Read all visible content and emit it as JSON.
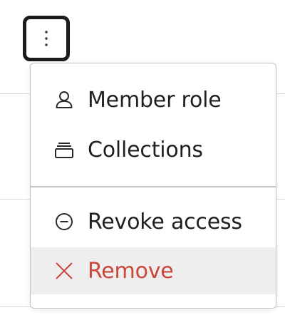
{
  "kebab_button": {
    "icon": "vertical-ellipsis-icon",
    "border_color": "#1c1c1e"
  },
  "menu": {
    "items": [
      {
        "label": "Member role",
        "icon": "user-icon",
        "color": "#1f2024"
      },
      {
        "label": "Collections",
        "icon": "collection-icon",
        "color": "#1f2024"
      },
      {
        "label": "Revoke access",
        "icon": "minus-circle-icon",
        "color": "#1f2024"
      },
      {
        "label": "Remove",
        "icon": "close-icon",
        "color": "#c8463a",
        "highlighted": true
      }
    ],
    "hover_background": "#eeeeee",
    "danger_color": "#c8463a"
  }
}
